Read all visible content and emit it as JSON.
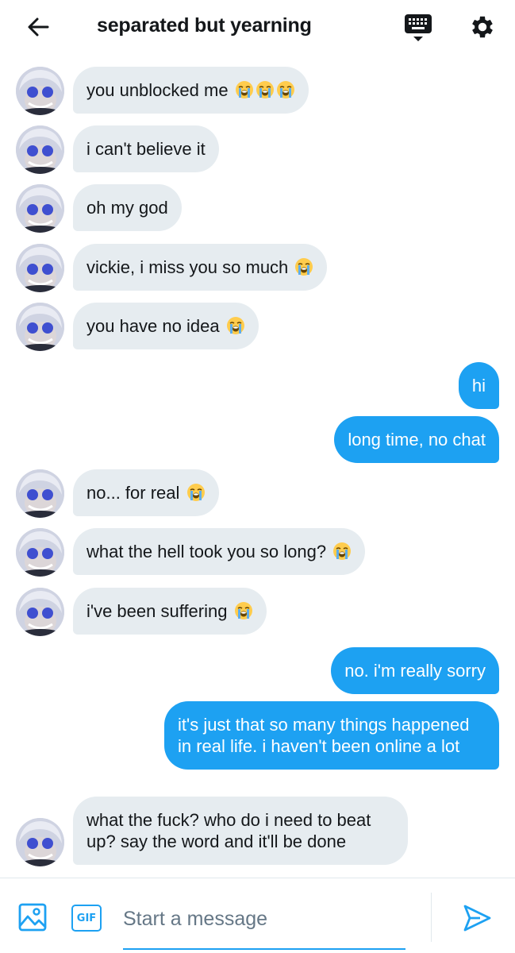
{
  "header": {
    "title": "separated but yearning",
    "back_icon": "back-arrow-icon",
    "keyboard_icon": "keyboard-icon",
    "settings_icon": "gear-icon"
  },
  "messages": [
    {
      "direction": "in",
      "text": "you unblocked me",
      "emoji_count": 3
    },
    {
      "direction": "in",
      "text": "i can't believe it",
      "emoji_count": 0
    },
    {
      "direction": "in",
      "text": "oh my god",
      "emoji_count": 0
    },
    {
      "direction": "in",
      "text": "vickie, i miss you so much",
      "emoji_count": 1
    },
    {
      "direction": "in",
      "text": "you have no idea",
      "emoji_count": 1
    },
    {
      "direction": "out",
      "text": "hi"
    },
    {
      "direction": "out",
      "text": "long time, no chat"
    },
    {
      "direction": "in",
      "text": "no... for real",
      "emoji_count": 1
    },
    {
      "direction": "in",
      "text": "what the hell took you so long?",
      "emoji_count": 1
    },
    {
      "direction": "in",
      "text": "i've been suffering",
      "emoji_count": 1
    },
    {
      "direction": "out",
      "text": "no. i'm really sorry"
    },
    {
      "direction": "out",
      "text": "it's just that so many things happened in real life. i haven't been online a lot"
    },
    {
      "direction": "in",
      "text": "what the fuck? who do i need to beat up? say the word and it'll be done",
      "emoji_count": 0
    }
  ],
  "composer": {
    "image_icon": "image-icon",
    "gif_label": "GIF",
    "placeholder": "Start a message",
    "value": "",
    "send_icon": "send-icon"
  },
  "colors": {
    "accent": "#1da1f2",
    "incoming_bubble": "#e6ecf0",
    "text": "#14171a"
  }
}
